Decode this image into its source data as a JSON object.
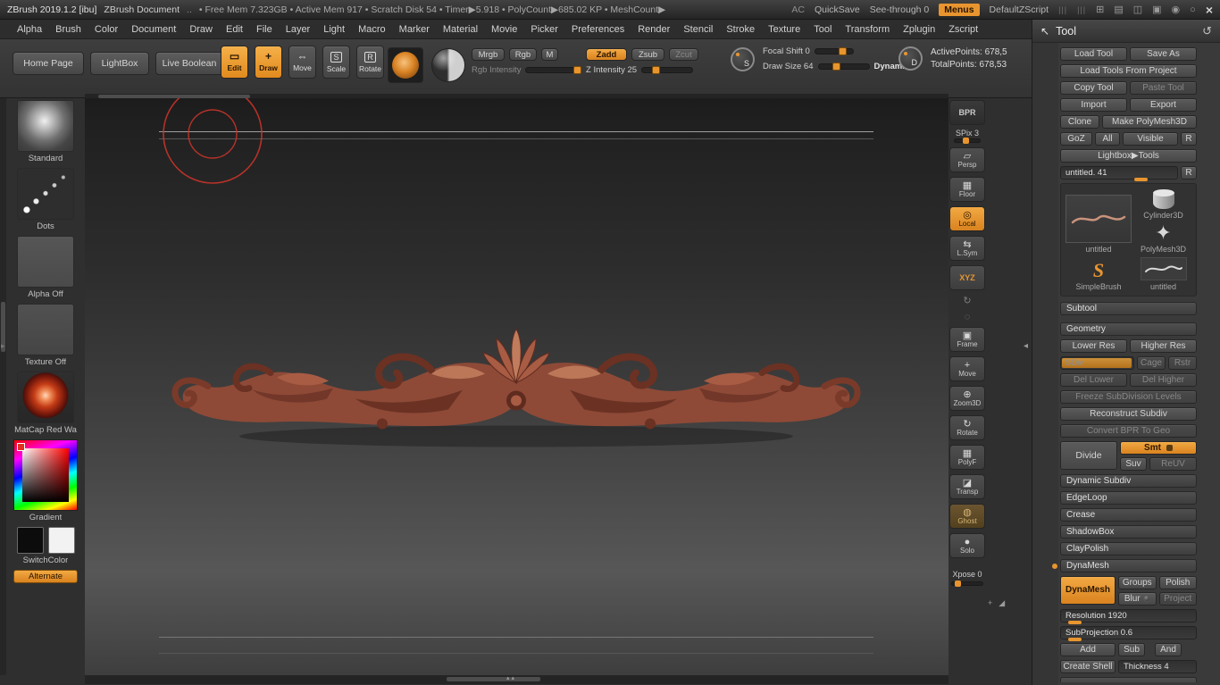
{
  "colors": {
    "accent": "#e8952f",
    "ornament_base": "#8e4a37",
    "red_ring": "#d2352a"
  },
  "titlebar": {
    "app_title": "ZBrush 2019.1.2 [ibu]",
    "doc_title": "ZBrush Document",
    "dots": "..",
    "stats": "• Free Mem 7.323GB • Active Mem 917 • Scratch Disk 54 • Timer▶5.918 • PolyCount▶685.02 KP • MeshCount▶",
    "ac": "AC",
    "quicksave": "QuickSave",
    "see_through": "See-through 0",
    "menus": "Menus",
    "zscript": "DefaultZScript",
    "grip": "|||",
    "icons": {
      "add": "⊞",
      "screens": "▤",
      "panels": "◫",
      "lock": "▣",
      "user": "◉",
      "power": "○",
      "close": "×"
    }
  },
  "menubar": {
    "items": [
      "Alpha",
      "Brush",
      "Color",
      "Document",
      "Draw",
      "Edit",
      "File",
      "Layer",
      "Light",
      "Macro",
      "Marker",
      "Material",
      "Movie",
      "Picker",
      "Preferences",
      "Render",
      "Stencil",
      "Stroke",
      "Texture",
      "Tool",
      "Transform",
      "Zplugin",
      "Zscript"
    ]
  },
  "shelf": {
    "home_page": "Home Page",
    "lightbox": "LightBox",
    "live_boolean": "Live Boolean",
    "tools": [
      {
        "label": "Edit",
        "icon": "▭"
      },
      {
        "label": "Draw",
        "icon": "+"
      },
      {
        "label": "Move",
        "icon": "⇔"
      },
      {
        "label": "Scale",
        "icon": "S"
      },
      {
        "label": "Rotate",
        "icon": "R"
      }
    ],
    "mrgb": "Mrgb",
    "rgb": "Rgb",
    "m": "M",
    "zadd": "Zadd",
    "zsub": "Zsub",
    "zcut": "Zcut",
    "rgb_intensity": "Rgb Intensity",
    "z_intensity": "Z Intensity 25",
    "focal_shift": "Focal Shift 0",
    "draw_size": "Draw Size 64",
    "dynamic": "Dynamic",
    "s_dial": "S",
    "d_dial": "D",
    "active_points": "ActivePoints: 678,5",
    "total_points": "TotalPoints: 678,53"
  },
  "left_tray": {
    "standard": "Standard",
    "dots": "Dots",
    "alpha_off": "Alpha Off",
    "texture_off": "Texture Off",
    "matcap": "MatCap Red Wa",
    "gradient": "Gradient",
    "switchcolor": "SwitchColor",
    "alternate": "Alternate"
  },
  "right_shelf": {
    "items": [
      {
        "label": "BPR",
        "icon": ""
      },
      {
        "label": "SPix 3",
        "icon": ""
      },
      {
        "label": "Persp",
        "icon": "▱"
      },
      {
        "label": "Floor",
        "icon": "▦"
      },
      {
        "label": "Local",
        "icon": "◎"
      },
      {
        "label": "L.Sym",
        "icon": "⇆"
      },
      {
        "label": "XYZ",
        "icon": ""
      },
      {
        "label": "Frame",
        "icon": "▣"
      },
      {
        "label": "Move",
        "icon": "+"
      },
      {
        "label": "Zoom3D",
        "icon": "⊕"
      },
      {
        "label": "Rotate",
        "icon": "↻"
      },
      {
        "label": "PolyF",
        "icon": "▦"
      },
      {
        "label": "Transp",
        "icon": "◪"
      },
      {
        "label": "Ghost",
        "icon": "◍"
      },
      {
        "label": "Solo",
        "icon": "●"
      }
    ],
    "spin_icon": "↻",
    "target_icon": "◌",
    "xpose": "Xpose 0",
    "dock1": "+",
    "dock2": "◢"
  },
  "canvas": {
    "up_arrows": "▴▴"
  },
  "tool_panel": {
    "title": "Tool",
    "cursor_icon": "↖",
    "reset_icon": "↺",
    "load_tool": "Load Tool",
    "save_as": "Save As",
    "load_tools_from_project": "Load Tools From Project",
    "copy_tool": "Copy Tool",
    "paste_tool": "Paste Tool",
    "import": "Import",
    "export": "Export",
    "clone": "Clone",
    "make_polymesh3d": "Make PolyMesh3D",
    "goz": "GoZ",
    "all": "All",
    "visible": "Visible",
    "r": "R",
    "lightbox_tools": "Lightbox▶Tools",
    "tool_slider": "untitled. 41",
    "r2": "R",
    "thumbs": {
      "current": "untitled",
      "cylinder": "Cylinder3D",
      "polymesh": "PolyMesh3D",
      "simplebrush": "SimpleBrush",
      "untitled": "untitled"
    },
    "subtool": "Subtool",
    "geometry": "Geometry",
    "lower_res": "Lower Res",
    "higher_res": "Higher Res",
    "sdiv": "SDiv",
    "cage": "Cage",
    "rstr": "Rstr",
    "del_lower": "Del Lower",
    "del_higher": "Del Higher",
    "freeze_subdivision": "Freeze SubDivision Levels",
    "reconstruct_subdiv": "Reconstruct Subdiv",
    "convert_bpr": "Convert BPR To Geo",
    "divide": "Divide",
    "smt": "Smt",
    "suv": "Suv",
    "reuv": "ReUV",
    "dynamic_subdiv": "Dynamic Subdiv",
    "edgeloop": "EdgeLoop",
    "crease": "Crease",
    "shadowbox": "ShadowBox",
    "claypolish": "ClayPolish",
    "dynamesh_header": "DynaMesh",
    "dynamesh": "DynaMesh",
    "groups": "Groups",
    "polish": "Polish",
    "blur": "Blur",
    "project": "Project",
    "resolution": "Resolution 1920",
    "subprojection": "SubProjection 0.6",
    "add": "Add",
    "sub": "Sub",
    "and": "And",
    "create_shell": "Create Shell",
    "thickness": "Thickness 4"
  }
}
